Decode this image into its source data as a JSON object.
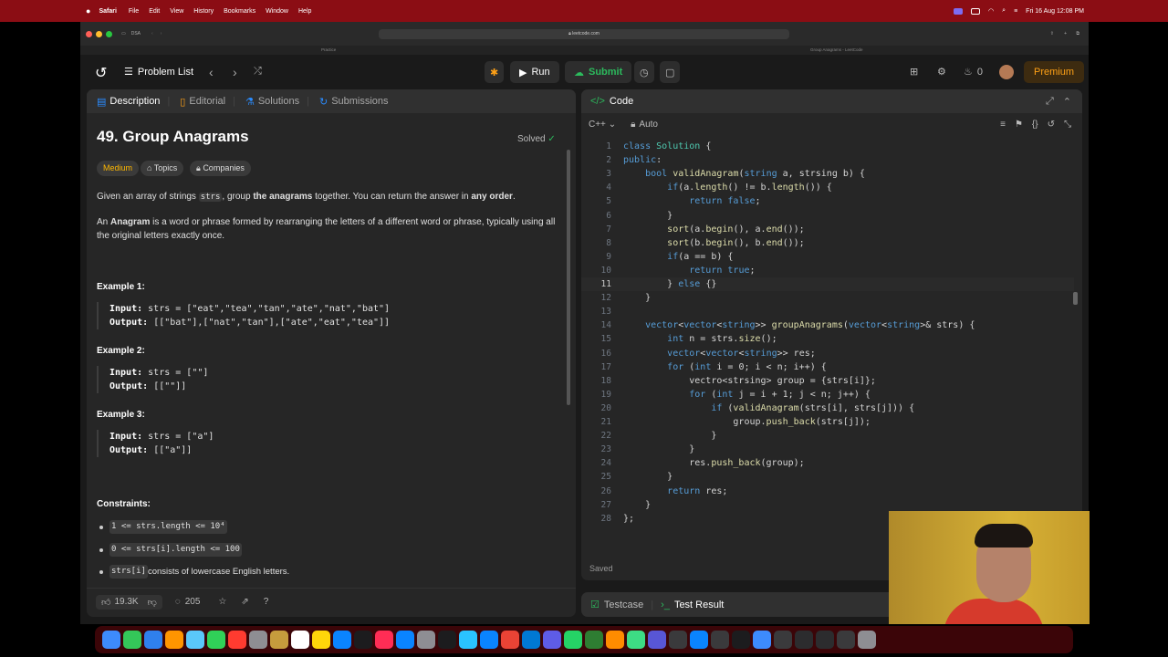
{
  "menubar": {
    "app": "Safari",
    "items": [
      "File",
      "Edit",
      "View",
      "History",
      "Bookmarks",
      "Window",
      "Help"
    ],
    "clock": "Fri 16 Aug 12:08 PM"
  },
  "safari": {
    "sidebar_label": "DSA",
    "url": "leetcode.com",
    "tab_left": "Practice",
    "tab_right": "Group Anagrams - LeetCode"
  },
  "nav": {
    "problem_list": "Problem List",
    "run": "Run",
    "submit": "Submit",
    "streak": "0",
    "premium": "Premium"
  },
  "left_tabs": [
    "Description",
    "Editorial",
    "Solutions",
    "Submissions"
  ],
  "problem": {
    "title": "49. Group Anagrams",
    "status": "Solved",
    "difficulty": "Medium",
    "topics": "Topics",
    "companies": "Companies",
    "para1_a": "Given an array of strings ",
    "para1_code": "strs",
    "para1_b": ", group ",
    "para1_bold": "the anagrams",
    "para1_c": " together. You can return the answer in ",
    "para1_bold2": "any order",
    "para1_d": ".",
    "para2_a": "An ",
    "para2_bold": "Anagram",
    "para2_b": " is a word or phrase formed by rearranging the letters of a different word or phrase, typically using all the original letters exactly once.",
    "examples": [
      {
        "title": "Example 1:",
        "input": "strs = [\"eat\",\"tea\",\"tan\",\"ate\",\"nat\",\"bat\"]",
        "output": "[[\"bat\"],[\"nat\",\"tan\"],[\"ate\",\"eat\",\"tea\"]]"
      },
      {
        "title": "Example 2:",
        "input": "strs = [\"\"]",
        "output": "[[\"\"]]"
      },
      {
        "title": "Example 3:",
        "input": "strs = [\"a\"]",
        "output": "[[\"a\"]]"
      }
    ],
    "input_label": "Input:",
    "output_label": "Output:",
    "constraints_title": "Constraints:",
    "constraints": [
      "1 <= strs.length <= 10⁴",
      "0 <= strs[i].length <= 100"
    ],
    "constraint3_code": "strs[i]",
    "constraint3_text": " consists of lowercase English letters."
  },
  "stats": {
    "likes": "19.3K",
    "comments": "205"
  },
  "editor": {
    "title": "Code",
    "language": "C++",
    "mode": "Auto",
    "saved": "Saved",
    "lines": [
      "class Solution {",
      "public:",
      "    bool validAnagram(string a, strsing b) {",
      "        if(a.length() != b.length()) {",
      "            return false;",
      "        }",
      "        sort(a.begin(), a.end());",
      "        sort(b.begin(), b.end());",
      "        if(a == b) {",
      "            return true;",
      "        } else {}",
      "    }",
      "",
      "    vector<vector<string>> groupAnagrams(vector<string>& strs) {",
      "        int n = strs.size();",
      "        vector<vector<string>> res;",
      "        for (int i = 0; i < n; i++) {",
      "            vectro<strsing> group = {strs[i]};",
      "            for (int j = i + 1; j < n; j++) {",
      "                if (validAnagram(strs[i], strs[j])) {",
      "                    group.push_back(strs[j]);",
      "                }",
      "            }",
      "            res.push_back(group);",
      "        }",
      "        return res;",
      "    }",
      "};"
    ]
  },
  "bottom_tabs": [
    "Testcase",
    "Test Result"
  ],
  "colors": {
    "accent": "#ffa116",
    "submit": "#2cbb5d",
    "menubar": "#8b0d14"
  }
}
